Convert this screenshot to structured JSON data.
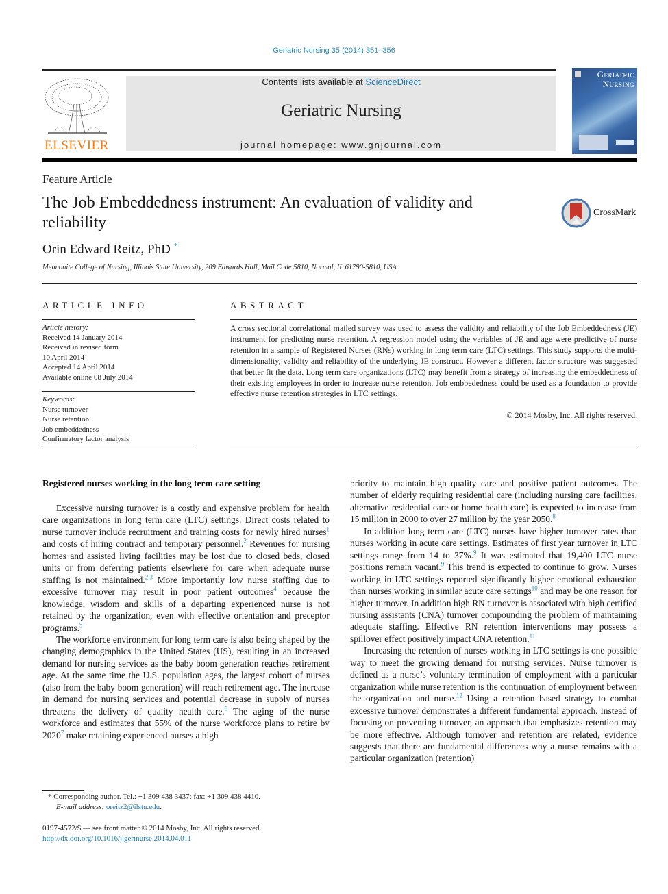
{
  "journal": {
    "citation": "Geriatric Nursing 35 (2014) 351–356",
    "contents_prefix": "Contents lists available at ",
    "contents_link": "ScienceDirect",
    "name": "Geriatric Nursing",
    "homepage": "journal homepage: www.gnjournal.com",
    "publisher_logo_text": "ELSEVIER",
    "cover_title_line1": "Geriatric",
    "cover_title_line2": "Nursing",
    "crossmark_label": "CrossMark"
  },
  "colors": {
    "link": "#1f7fb2",
    "publisher_orange": "#f07a12",
    "banner_bg": "#e6e6e6"
  },
  "article": {
    "type": "Feature Article",
    "title": "The Job Embeddedness instrument: An evaluation of validity and reliability",
    "author": "Orin Edward Reitz, PhD",
    "author_mark": "*",
    "affiliation": "Mennonite College of Nursing, Illinois State University, 209 Edwards Hall, Mail Code 5810, Normal, IL 61790-5810, USA"
  },
  "article_info": {
    "heading": "ARTICLE INFO",
    "history_label": "Article history:",
    "history": [
      "Received 14 January 2014",
      "Received in revised form",
      "10 April 2014",
      "Accepted 14 April 2014",
      "Available online 08 July 2014"
    ],
    "keywords_label": "Keywords:",
    "keywords": [
      "Nurse turnover",
      "Nurse retention",
      "Job embeddedness",
      "Confirmatory factor analysis"
    ]
  },
  "abstract": {
    "heading": "ABSTRACT",
    "text": "A cross sectional correlational mailed survey was used to assess the validity and reliability of the Job Embeddedness (JE) instrument for predicting nurse retention. A regression model using the variables of JE and age were predictive of nurse retention in a sample of Registered Nurses (RNs) working in long term care (LTC) settings. This study supports the multi-dimensionality, validity and reliability of the underlying JE construct. However a different factor structure was suggested that better fit the data. Long term care organizations (LTC) may benefit from a strategy of increasing the embeddedness of their existing employees in order to increase nurse retention. Job embbededness could be used as a foundation to provide effective nurse retention strategies in LTC settings.",
    "copyright": "© 2014 Mosby, Inc. All rights reserved."
  },
  "body": {
    "section_heading": "Registered nurses working in the long term care setting",
    "left_paragraphs": [
      {
        "parts": [
          {
            "t": "Excessive nursing turnover is a costly and expensive problem for health care organizations in long term care (LTC) settings. Direct costs related to nurse turnover include recruitment and training costs for newly hired nurses"
          },
          {
            "ref": "1"
          },
          {
            "t": " and costs of hiring contract and temporary personnel."
          },
          {
            "ref": "2"
          },
          {
            "t": " Revenues for nursing homes and assisted living facilities may be lost due to closed beds, closed units or from deferring patients elsewhere for care when adequate nurse staffing is not maintained."
          },
          {
            "ref": "2,3"
          },
          {
            "t": " More importantly low nurse staffing due to excessive turnover may result in poor patient outcomes"
          },
          {
            "ref": "4"
          },
          {
            "t": " because the knowledge, wisdom and skills of a departing experienced nurse is not retained by the organization, even with effective orientation and preceptor programs."
          },
          {
            "ref": "5"
          }
        ]
      },
      {
        "parts": [
          {
            "t": "The workforce environment for long term care is also being shaped by the changing demographics in the United States (US), resulting in an increased demand for nursing services as the baby boom generation reaches retirement age. At the same time the U.S. population ages, the largest cohort of nurses (also from the baby boom generation) will reach retirement age. The increase in demand for nursing services and potential decrease in supply of nurses threatens the delivery of quality health care."
          },
          {
            "ref": "6"
          },
          {
            "t": " The aging of the nurse workforce and estimates that 55% of the nurse workforce plans to retire by 2020"
          },
          {
            "ref": "7"
          },
          {
            "t": " make retaining experienced nurses a high"
          }
        ]
      }
    ],
    "right_paragraphs": [
      {
        "noindent": true,
        "parts": [
          {
            "t": "priority to maintain high quality care and positive patient outcomes. The number of elderly requiring residential care (including nursing care facilities, alternative residential care or home health care) is expected to increase from 15 million in 2000 to over 27 million by the year 2050."
          },
          {
            "ref": "8"
          }
        ]
      },
      {
        "parts": [
          {
            "t": "In addition long term care (LTC) nurses have higher turnover rates than nurses working in acute care settings. Estimates of first year turnover in LTC settings range from 14 to 37%."
          },
          {
            "ref": "9"
          },
          {
            "t": " It was estimated that 19,400 LTC nurse positions remain vacant."
          },
          {
            "ref": "9"
          },
          {
            "t": " This trend is expected to continue to grow. Nurses working in LTC settings reported significantly higher emotional exhaustion than nurses working in similar acute care settings"
          },
          {
            "ref": "10"
          },
          {
            "t": " and may be one reason for higher turnover. In addition high RN turnover is associated with high certified nursing assistants (CNA) turnover compounding the problem of maintaining adequate staffing. Effective RN retention interventions may possess a spillover effect positively impact CNA retention."
          },
          {
            "ref": "11"
          }
        ]
      },
      {
        "parts": [
          {
            "t": "Increasing the retention of nurses working in LTC settings is one possible way to meet the growing demand for nursing services. Nurse turnover is defined as a nurse’s voluntary termination of employment with a particular organization while nurse retention is the continuation of employment between the organization and nurse."
          },
          {
            "ref": "12"
          },
          {
            "t": " Using a retention based strategy to combat excessive turnover demonstrates a different fundamental approach. Instead of focusing on preventing turnover, an approach that emphasizes retention may be more effective. Although turnover and retention are related, evidence suggests that there are fundamental differences why a nurse remains with a particular organization (retention)"
          }
        ]
      }
    ]
  },
  "footnotes": {
    "corresponding": "* Corresponding author. Tel.: +1 309 438 3437; fax: +1 309 438 4410.",
    "email_label": "E-mail address: ",
    "email": "oreitz2@ilstu.edu",
    "email_end": ".",
    "front_matter": "0197-4572/$ — see front matter © 2014 Mosby, Inc. All rights reserved.",
    "doi": "http://dx.doi.org/10.1016/j.gerinurse.2014.04.011"
  }
}
